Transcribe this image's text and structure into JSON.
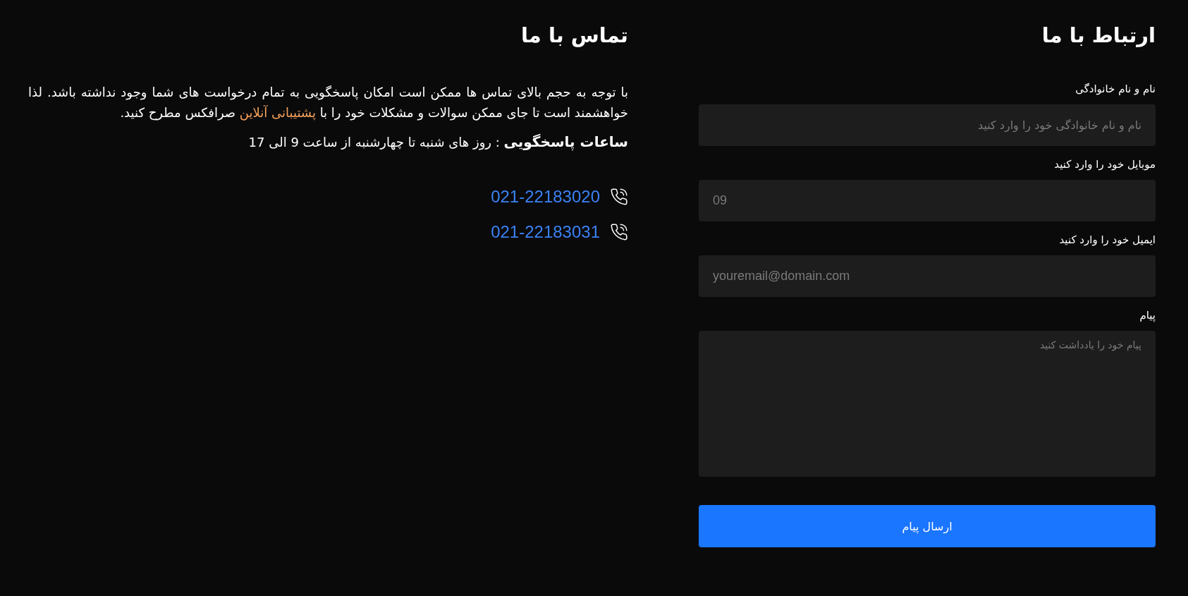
{
  "form": {
    "title": "ارتباط با ما",
    "fields": [
      {
        "kind": "input",
        "label": "نام و نام خانوادگی",
        "placeholder": "نام و نام خانوادگی خود را وارد کنید"
      },
      {
        "kind": "phone",
        "label": "موبایل خود را وارد کنید",
        "placeholder": "09"
      },
      {
        "kind": "email",
        "label": "ایمیل خود را وارد کنید",
        "placeholder": "youremail@domain.com"
      },
      {
        "kind": "textarea",
        "label": "پیام",
        "placeholder": "پیام خود را یادداشت کنید"
      }
    ],
    "submit": "ارسال پیام"
  },
  "contact": {
    "title": "تماس با ما",
    "paragraph_before": "با توجه به حجم بالای تماس ها ممکن است امکان پاسخگویی به تمام درخواست های شما وجود نداشته باشد. لذا خواهشمند است تا جای ممکن سوالات و مشکلات خود را با",
    "link": "پشتیبانی آنلاین",
    "paragraph_after": "صرافکس مطرح کنید.",
    "hours": "**ساعات پاسخگویی** : روز های شنبه تا چهارشنبه از ساعت 9 الی 17",
    "phones": [
      "021-22183020",
      "021-22183031"
    ]
  }
}
